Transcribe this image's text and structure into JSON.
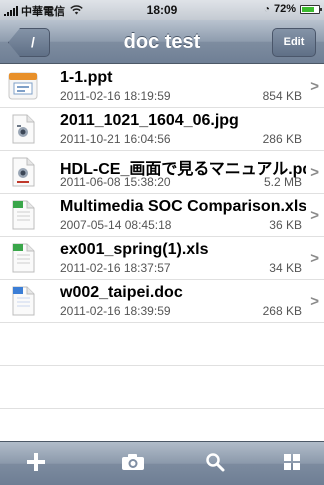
{
  "status_bar": {
    "carrier": "中華電信",
    "time": "18:09",
    "battery": "72%",
    "battery_level": 0.72
  },
  "nav": {
    "back_label": "/",
    "title": "doc test",
    "edit_label": "Edit"
  },
  "files": [
    {
      "name": "1-1.ppt",
      "date": "2011-02-16 18:19:59",
      "size": "854 KB",
      "icon": "ppt-file-icon"
    },
    {
      "name": "2011_1021_1604_06.jpg",
      "date": "2011-10-21 16:04:56",
      "size": "286 KB",
      "icon": "image-file-icon"
    },
    {
      "name": "HDL-CE_画面で見るマニュアル.pdf",
      "date": "2011-06-08 15:38:20",
      "size": "5.2 MB",
      "icon": "pdf-file-icon"
    },
    {
      "name": "Multimedia SOC Comparison.xls",
      "date": "2007-05-14 08:45:18",
      "size": "36 KB",
      "icon": "xls-file-icon"
    },
    {
      "name": "ex001_spring(1).xls",
      "date": "2011-02-16 18:37:57",
      "size": "34 KB",
      "icon": "xls-file-icon"
    },
    {
      "name": "w002_taipei.doc",
      "date": "2011-02-16 18:39:59",
      "size": "268 KB",
      "icon": "doc-file-icon"
    }
  ],
  "toolbar": {
    "icons": [
      "add-icon",
      "camera-icon",
      "search-icon",
      "grid-icon"
    ]
  },
  "colors": {
    "nav_bar": "#8e9cae",
    "ppt_accent": "#e8902a",
    "xls_accent": "#3aa64a",
    "doc_accent": "#3b7ed6"
  }
}
